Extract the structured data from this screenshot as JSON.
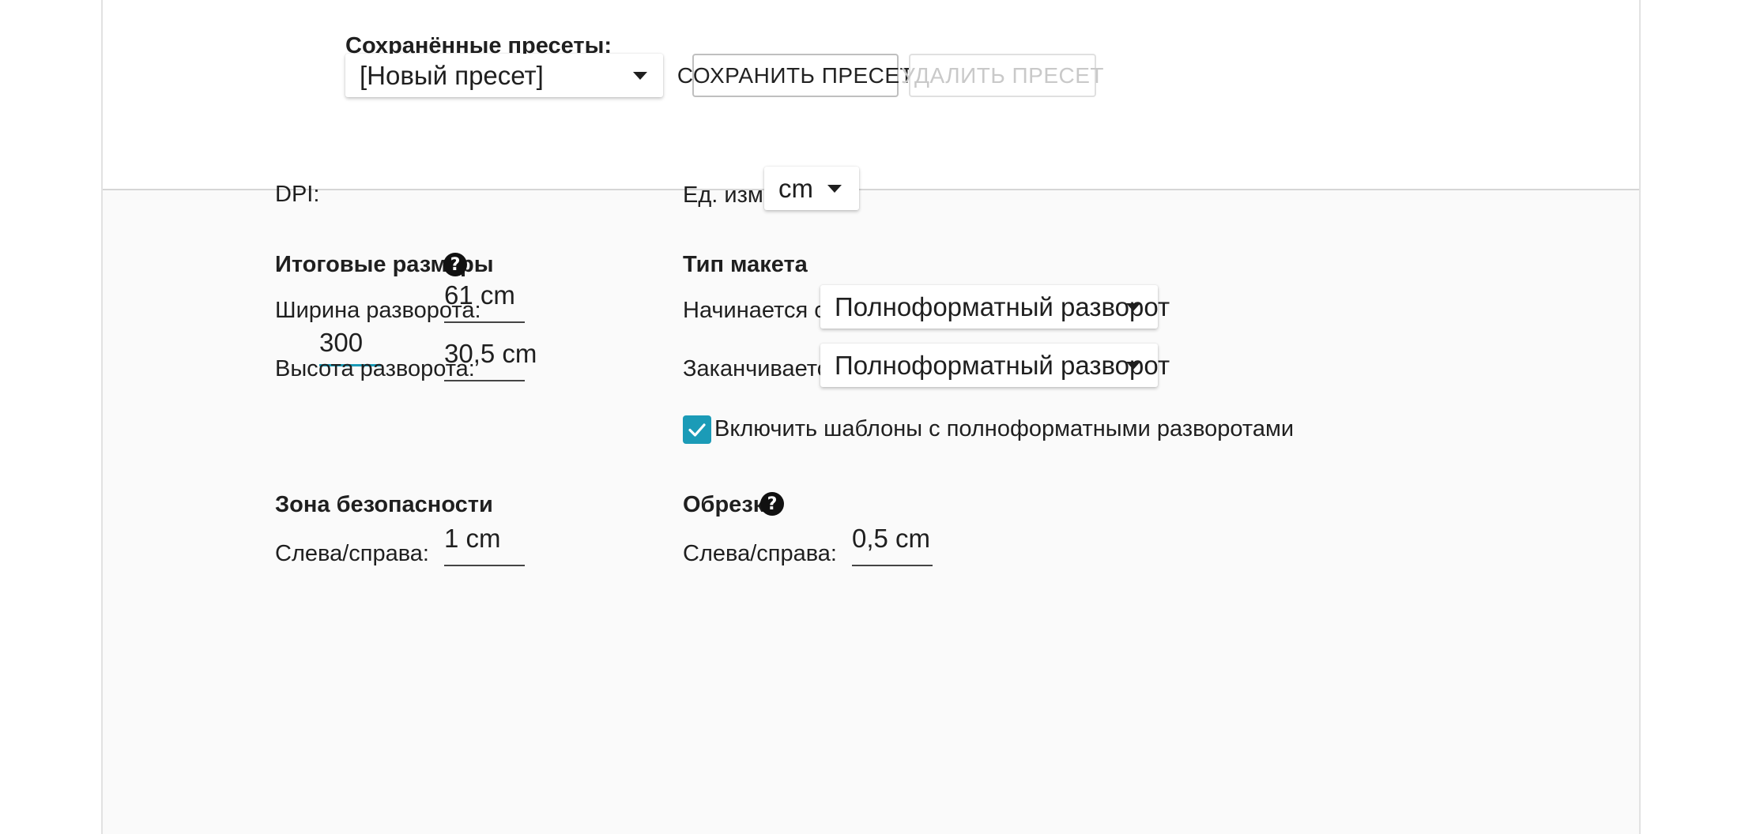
{
  "presets": {
    "heading": "Сохранённые пресеты:",
    "selected": "[Новый пресет]",
    "save_button": "СОХРАНИТЬ ПРЕСЕТ",
    "delete_button": "УДАЛИТЬ ПРЕСЕТ"
  },
  "dpi": {
    "label": "DPI:",
    "value": "300"
  },
  "units": {
    "label": "Ед. изм.:",
    "selected": "cm"
  },
  "final_size": {
    "heading": "Итоговые размеры",
    "width_label": "Ширина разворота:",
    "width_value": "61 cm",
    "height_label": "Высота разворота:",
    "height_value": "30,5 cm"
  },
  "layout_type": {
    "heading": "Тип макета",
    "starts_label": "Начинается с:",
    "starts_value": "Полноформатный разворот",
    "ends_label": "Заканчивается:",
    "ends_value": "Полноформатный разворот",
    "include_templates_label": "Включить шаблоны с полноформатными разворотами",
    "include_templates_checked": true
  },
  "safe_zone": {
    "heading": "Зона безопасности",
    "lr_label": "Слева/справа:",
    "lr_value": "1 cm"
  },
  "trim": {
    "heading": "Обрезка",
    "lr_label": "Слева/справа:",
    "lr_value": "0,5 cm"
  },
  "colors": {
    "accent": "#1b9bb7",
    "divider": "#d6d6d6"
  },
  "icons": {
    "dropdown": "caret-down-icon",
    "help": "question-circle-icon",
    "check": "check-icon"
  }
}
